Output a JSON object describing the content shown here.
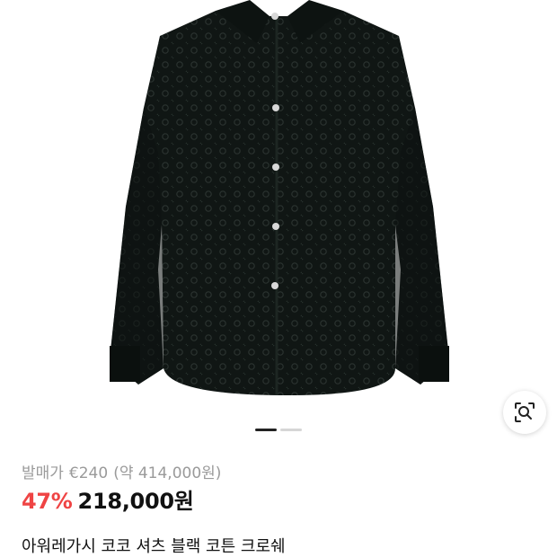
{
  "product": {
    "image_alt": "black crochet button-up shirt",
    "original_price": {
      "label": "발매가",
      "value": "€240",
      "converted": "(약 414,000원)"
    },
    "discount": "47%",
    "price": "218,000원",
    "title": "아워레가시 코코 셔츠 블랙 코튼 크로쉐"
  },
  "gallery": {
    "total_pages": 2,
    "current_page": 1
  },
  "icons": {
    "image_search": "lens-search-icon"
  },
  "colors": {
    "discount": "#ef4444",
    "text": "#111111",
    "muted": "#9a9a9a",
    "shirt": "#101614"
  }
}
